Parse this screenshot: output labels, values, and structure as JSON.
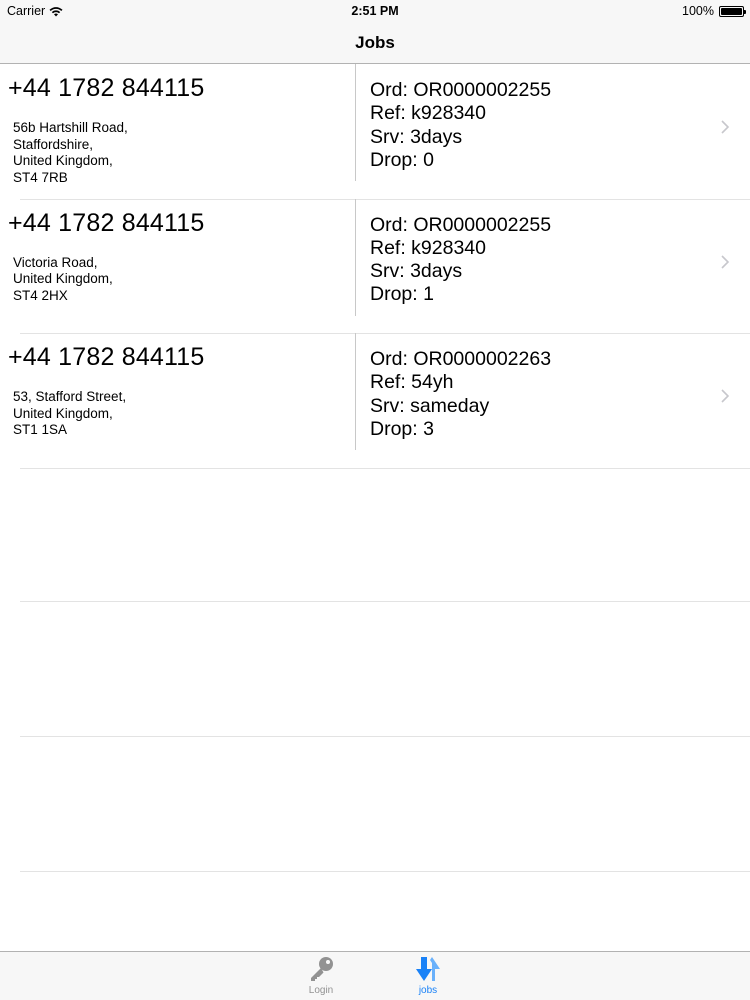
{
  "status_bar": {
    "carrier": "Carrier",
    "time": "2:51 PM",
    "battery": "100%",
    "icons": [
      "wifi-icon",
      "battery-icon"
    ]
  },
  "nav": {
    "title": "Jobs"
  },
  "jobs": [
    {
      "phone": "+44 1782 844115",
      "address": [
        "56b Hartshill Road,",
        "Staffordshire,",
        "United Kingdom,",
        "ST4 7RB"
      ],
      "ord": "Ord: OR0000002255",
      "ref": "Ref: k928340",
      "srv": "Srv: 3days",
      "drop": "Drop: 0"
    },
    {
      "phone": "+44 1782 844115",
      "address": [
        "Victoria Road,",
        "United Kingdom,",
        "ST4 2HX"
      ],
      "ord": "Ord: OR0000002255",
      "ref": "Ref: k928340",
      "srv": "Srv: 3days",
      "drop": "Drop: 1"
    },
    {
      "phone": "+44 1782 844115",
      "address": [
        "53, Stafford Street,",
        "United Kingdom,",
        "ST1 1SA"
      ],
      "ord": "Ord: OR0000002263",
      "ref": "Ref: 54yh",
      "srv": "Srv: sameday",
      "drop": "Drop: 3"
    }
  ],
  "tabs": [
    {
      "label": "Login",
      "icon": "key-icon",
      "selected": false
    },
    {
      "label": "jobs",
      "icon": "arrows-icon",
      "selected": true
    }
  ],
  "colors": {
    "accent": "#1a82f7",
    "inactive": "#929292",
    "bar_bg": "#f7f7f7"
  }
}
